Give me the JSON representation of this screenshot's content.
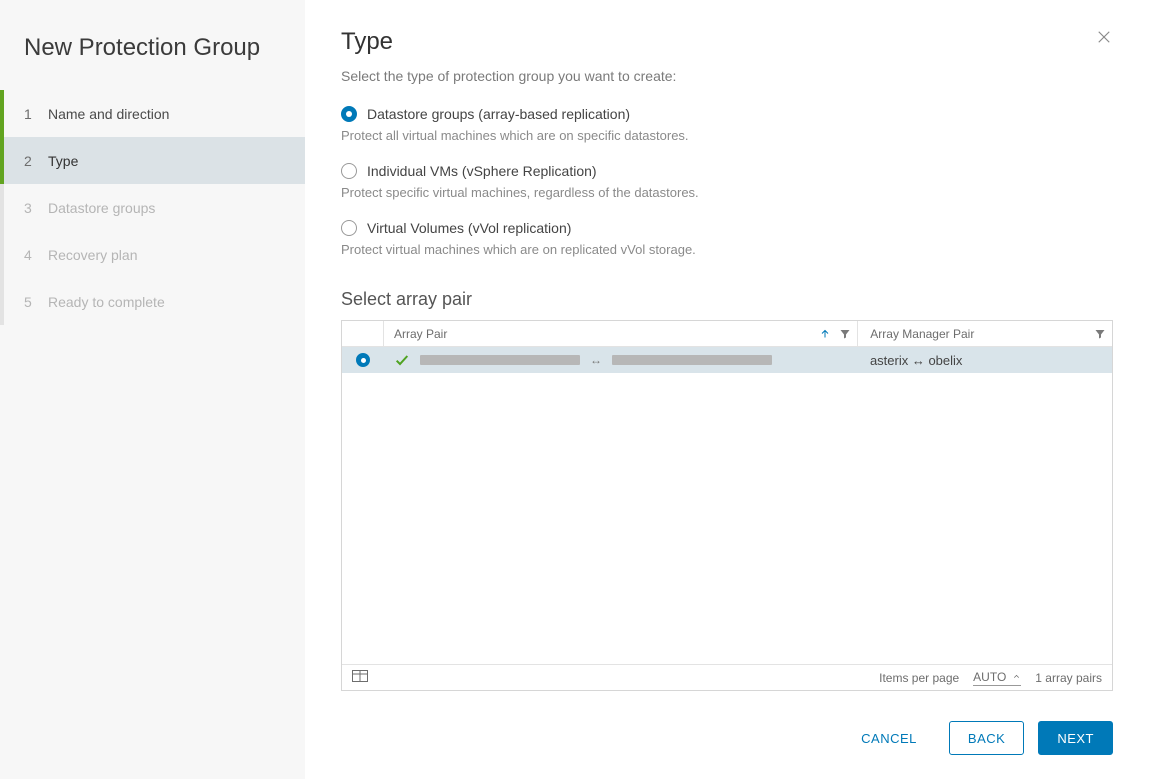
{
  "sidebar": {
    "title": "New Protection Group",
    "steps": [
      {
        "num": "1",
        "label": "Name and direction",
        "state": "done"
      },
      {
        "num": "2",
        "label": "Type",
        "state": "active"
      },
      {
        "num": "3",
        "label": "Datastore groups",
        "state": "future"
      },
      {
        "num": "4",
        "label": "Recovery plan",
        "state": "future"
      },
      {
        "num": "5",
        "label": "Ready to complete",
        "state": "future"
      }
    ]
  },
  "page": {
    "title": "Type",
    "subtitle": "Select the type of protection group you want to create:"
  },
  "options": [
    {
      "id": "datastore",
      "label": "Datastore groups (array-based replication)",
      "desc": "Protect all virtual machines which are on specific datastores.",
      "selected": true
    },
    {
      "id": "vms",
      "label": "Individual VMs (vSphere Replication)",
      "desc": "Protect specific virtual machines, regardless of the datastores.",
      "selected": false
    },
    {
      "id": "vvol",
      "label": "Virtual Volumes (vVol replication)",
      "desc": "Protect virtual machines which are on replicated vVol storage.",
      "selected": false
    }
  ],
  "arraypair": {
    "section_title": "Select array pair",
    "columns": {
      "pair": "Array Pair",
      "mgr": "Array Manager Pair"
    },
    "rows": [
      {
        "selected": true,
        "status": "ok",
        "mgr": "asterix ↔ obelix"
      }
    ],
    "footer": {
      "ipp_label": "Items per page",
      "ipp_value": "AUTO",
      "count_label": "1 array pairs"
    }
  },
  "buttons": {
    "cancel": "Cancel",
    "back": "Back",
    "next": "Next"
  }
}
